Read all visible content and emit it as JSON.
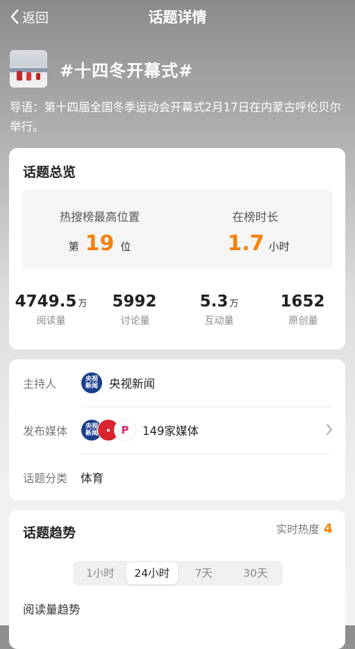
{
  "nav": {
    "back_label": "返回",
    "title": "话题详情"
  },
  "topic": {
    "title": "#十四冬开幕式#",
    "intro": "导语：第十四届全国冬季运动会开幕式2月17日在内蒙古呼伦贝尔举行。"
  },
  "overview": {
    "heading": "话题总览",
    "rank": {
      "label": "热搜榜最高位置",
      "prefix": "第",
      "value": "19",
      "suffix": "位"
    },
    "duration": {
      "label": "在榜时长",
      "value": "1.7",
      "unit": "小时"
    },
    "stats": [
      {
        "value": "4749.5",
        "unit": "万",
        "label": "阅读量"
      },
      {
        "value": "5992",
        "unit": "",
        "label": "讨论量"
      },
      {
        "value": "5.3",
        "unit": "万",
        "label": "互动量"
      },
      {
        "value": "1652",
        "unit": "",
        "label": "原创量"
      }
    ]
  },
  "info": {
    "host_label": "主持人",
    "host_value": "央视新闻",
    "media_label": "发布媒体",
    "media_value": "149家媒体",
    "category_label": "话题分类",
    "category_value": "体育",
    "logo_cctv_top": "央视",
    "logo_cctv_bottom": "新闻"
  },
  "trend": {
    "heading": "话题趋势",
    "heat_label": "实时热度",
    "heat_value": "4",
    "tabs": [
      "1小时",
      "24小时",
      "7天",
      "30天"
    ],
    "active_tab": "24小时",
    "chart_label": "阅读量趋势"
  },
  "colors": {
    "accent": "#f5820a",
    "cctv_blue": "#1a3e8c",
    "red": "#d8242b"
  }
}
